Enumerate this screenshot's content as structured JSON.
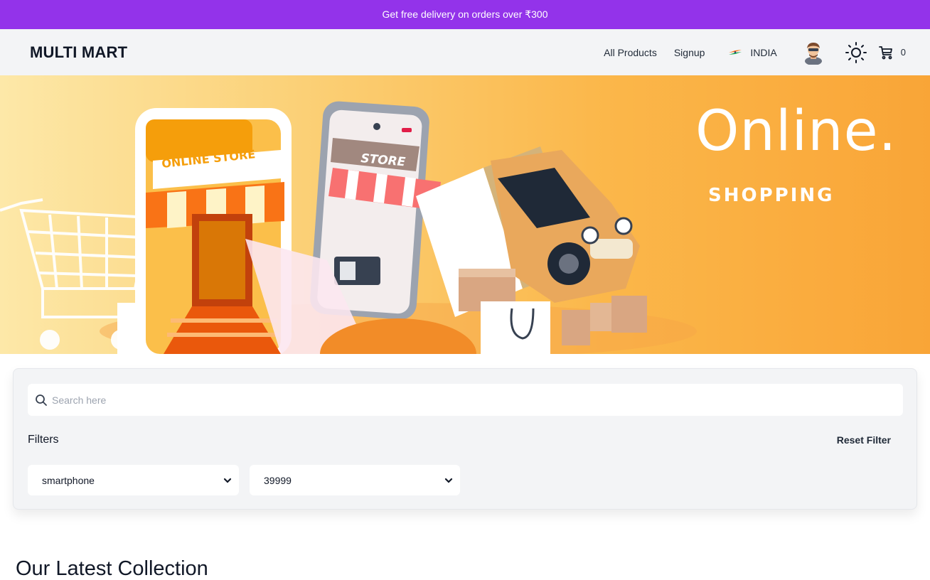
{
  "promo": {
    "text": "Get free delivery on orders over ₹300"
  },
  "navbar": {
    "brand": "MULTI MART",
    "links": [
      "All Products",
      "Signup"
    ],
    "country": "INDIA",
    "cart_count": "0"
  },
  "hero": {
    "title": "Online.",
    "subtitle": "SHOPPING",
    "store_sign": "ONLINE STORE",
    "phone_sign": "STORE"
  },
  "filters": {
    "search_placeholder": "Search here",
    "label": "Filters",
    "reset_label": "Reset Filter",
    "category_value": "smartphone",
    "price_value": "39999"
  },
  "collection": {
    "title": "Our Latest Collection"
  },
  "colors": {
    "promo": "#9333ea",
    "hero_orange": "#f9a537"
  }
}
